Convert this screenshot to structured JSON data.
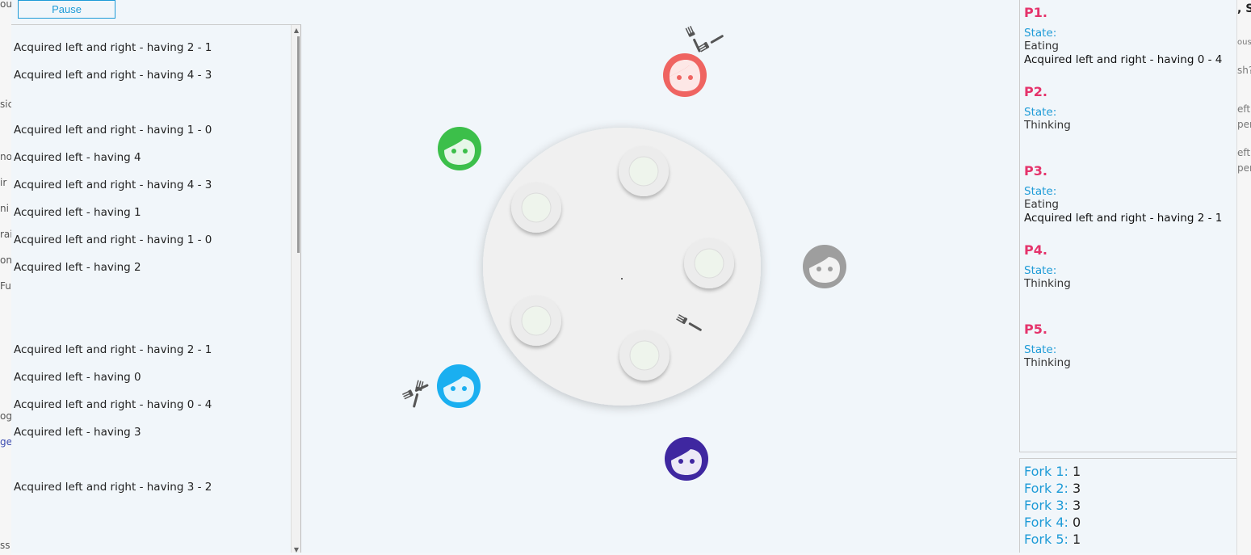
{
  "controls": {
    "pause_label": "Pause"
  },
  "log": [
    "Acquired left and right - having  2 - 1",
    "Acquired left and right - having  4 - 3",
    "",
    "Acquired left and right - having  1 - 0",
    "Acquired left - having  4",
    "Acquired left and right - having  4 - 3",
    "Acquired left - having  1",
    "Acquired left and right - having  1 - 0",
    "Acquired left - having  2",
    "",
    "",
    "Acquired left and right - having  2 - 1",
    "Acquired left - having  0",
    "Acquired left and right - having  0 - 4",
    "Acquired left - having  3",
    "",
    "Acquired left and right - having  3 - 2"
  ],
  "philosophers": [
    {
      "name": "P1.",
      "state_label": "State:",
      "state": "Eating",
      "detail": "Acquired left and right - having 0 - 4"
    },
    {
      "name": "P2.",
      "state_label": "State:",
      "state": "Thinking",
      "detail": ""
    },
    {
      "name": "P3.",
      "state_label": "State:",
      "state": "Eating",
      "detail": "Acquired left and right - having 2 - 1"
    },
    {
      "name": "P4.",
      "state_label": "State:",
      "state": "Thinking",
      "detail": ""
    },
    {
      "name": "P5.",
      "state_label": "State:",
      "state": "Thinking",
      "detail": ""
    }
  ],
  "forks": [
    {
      "label": "Fork 1:",
      "value": "1"
    },
    {
      "label": "Fork 2:",
      "value": "3"
    },
    {
      "label": "Fork 3:",
      "value": "3"
    },
    {
      "label": "Fork 4:",
      "value": "0"
    },
    {
      "label": "Fork 5:",
      "value": "1"
    }
  ],
  "colors": {
    "accent": "#1e9bd7",
    "philosopher_name": "#e5336b",
    "face_red": "#ef6461",
    "face_green": "#3cbf4a",
    "face_gray": "#9e9e9e",
    "face_blue": "#1aaff0",
    "face_purple": "#3f27a0"
  }
}
